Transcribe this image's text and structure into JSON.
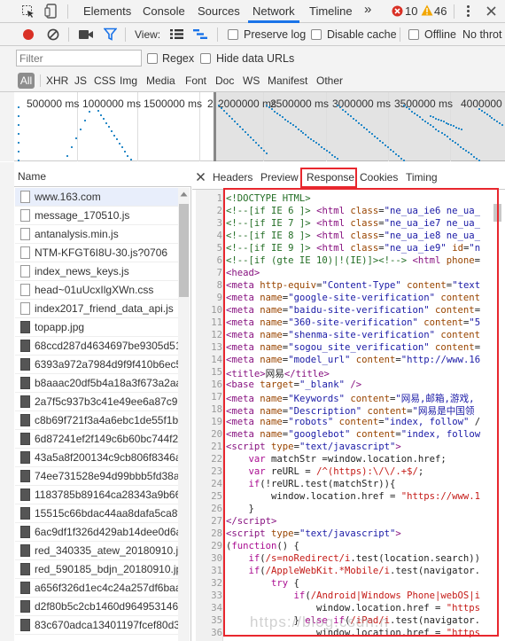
{
  "toolbar": {
    "tabs": [
      "Elements",
      "Console",
      "Sources",
      "Network",
      "Timeline"
    ],
    "active_tab": "Network",
    "overflow": "»",
    "errors": "10",
    "warnings": "46"
  },
  "controls": {
    "view_label": "View:",
    "preserve_log": "Preserve log",
    "disable_cache": "Disable cache",
    "offline": "Offline",
    "throttle": "No throt"
  },
  "filter": {
    "placeholder": "Filter",
    "regex": "Regex",
    "hide_data_urls": "Hide data URLs",
    "types": [
      "All",
      "XHR",
      "JS",
      "CSS",
      "Img",
      "Media",
      "Font",
      "Doc",
      "WS",
      "Manifest",
      "Other"
    ]
  },
  "timeline": {
    "ticks": [
      "500000 ms",
      "1000000 ms",
      "1500000 ms",
      "2",
      "2000000 ms",
      "2500000 ms",
      "3000000 ms",
      "3500000 ms",
      "4000000"
    ]
  },
  "name_header": "Name",
  "requests": [
    "www.163.com",
    "message_170510.js",
    "antanalysis.min.js",
    "NTM-KFGT6I8U-30.js?0706",
    "index_news_keys.js",
    "head~01uUcxIlgXWn.css",
    "index2017_friend_data_api.js",
    "topapp.jpg",
    "68ccd287d4634697be9305d51",
    "6393a972a7984d9f9f410b6ec5",
    "b8aaac20df5b4a18a3f673a2aa",
    "2a7f5c937b3c41e49ee6a87c9",
    "c8b69f721f3a4a6ebc1de55f1b",
    "6d87241ef2f149c6b60bc744f2",
    "43a5a8f200134c9cb806f8346a",
    "74ee731528e94d99bbb5fd38a3",
    "1183785b89164ca28343a9b66",
    "15515c66bdac44aa8dafa5ca8f",
    "6ac9df1f326d429ab14dee0d6a",
    "red_340335_atew_20180910.jp",
    "red_590185_bdjn_20180910.jp",
    "a656f326d1ec4c24a257df6baa",
    "d2f80b5c2cb1460d964953146",
    "83c670adca13401197fcef80d3"
  ],
  "detail_tabs": [
    "Headers",
    "Preview",
    "Response",
    "Cookies",
    "Timing"
  ],
  "active_detail_tab": "Response",
  "watermark": "https://blog.csdn.n",
  "colors": {
    "highlight": "#e8272e",
    "accent": "#1a73e8",
    "record": "#d93025"
  }
}
